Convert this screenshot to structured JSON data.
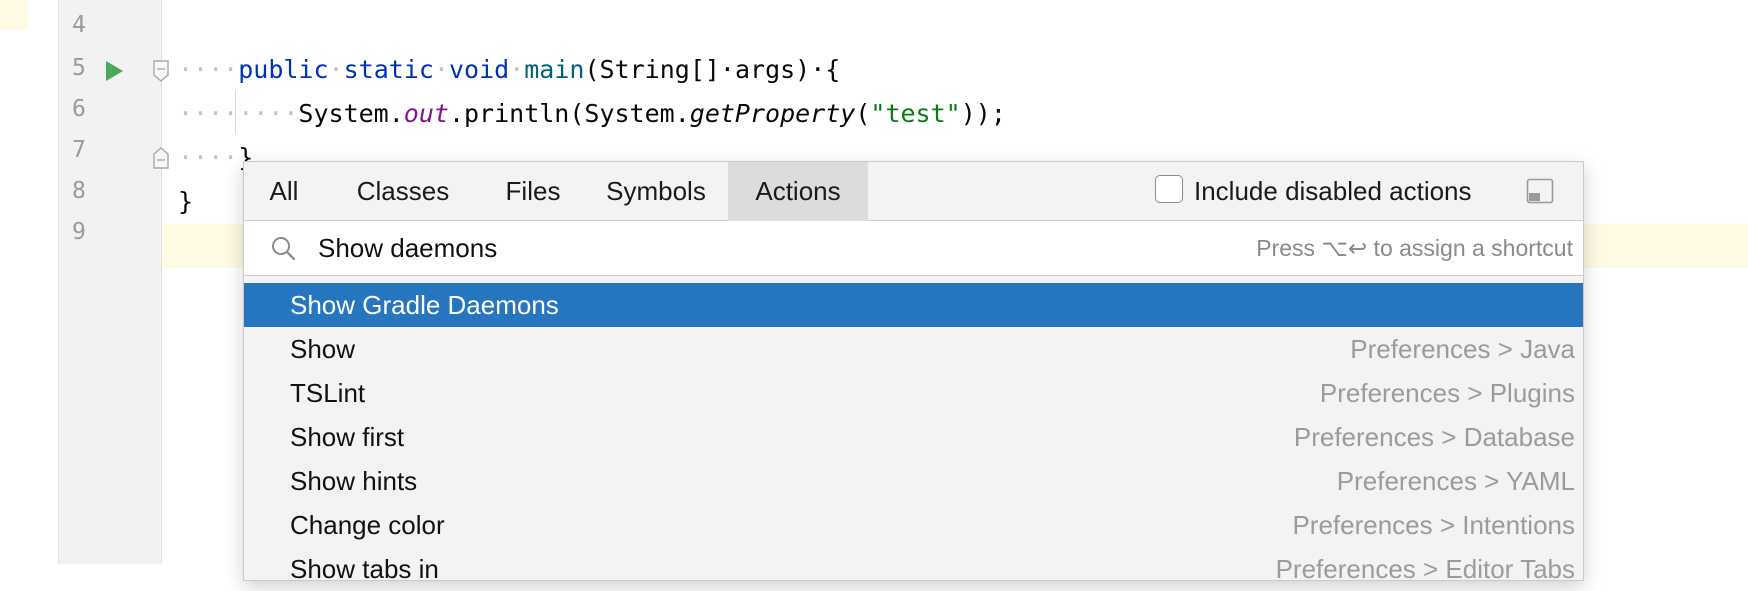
{
  "editor": {
    "line_numbers": [
      "4",
      "5",
      "6",
      "7",
      "8",
      "9"
    ],
    "code": {
      "line5": {
        "indent": "····",
        "kw1": "public",
        "kw2": "static",
        "kw3": "void",
        "method": "main",
        "params": "(String[]·args)·{"
      },
      "line6": {
        "indent": "········",
        "sys1": "System.",
        "field": "out",
        "call": ".println(System.",
        "method": "getProperty",
        "open": "(",
        "string": "\"test\"",
        "close": "));"
      },
      "line7": {
        "indent": "····",
        "brace": "}"
      },
      "line8": {
        "brace": "}"
      }
    }
  },
  "popup": {
    "tabs": [
      "All",
      "Classes",
      "Files",
      "Symbols",
      "Actions"
    ],
    "active_tab": "Actions",
    "include_disabled_label": "Include disabled actions",
    "search": {
      "value": "Show daemons",
      "hint": "Press ⌥↩ to assign a shortcut"
    },
    "results": [
      {
        "name": "Show Gradle Daemons",
        "location": ""
      },
      {
        "name": "Show",
        "location": "Preferences > Java"
      },
      {
        "name": "TSLint",
        "location": "Preferences > Plugins"
      },
      {
        "name": "Show first",
        "location": "Preferences > Database"
      },
      {
        "name": "Show hints",
        "location": "Preferences > YAML"
      },
      {
        "name": "Change color",
        "location": "Preferences > Intentions"
      },
      {
        "name": "Show tabs in",
        "location": "Preferences > Editor Tabs"
      }
    ]
  },
  "colors": {
    "selection": "#2675bf",
    "keyword": "#0033b3",
    "string": "#067d17",
    "field": "#871094",
    "run_icon": "#4aa85a"
  }
}
